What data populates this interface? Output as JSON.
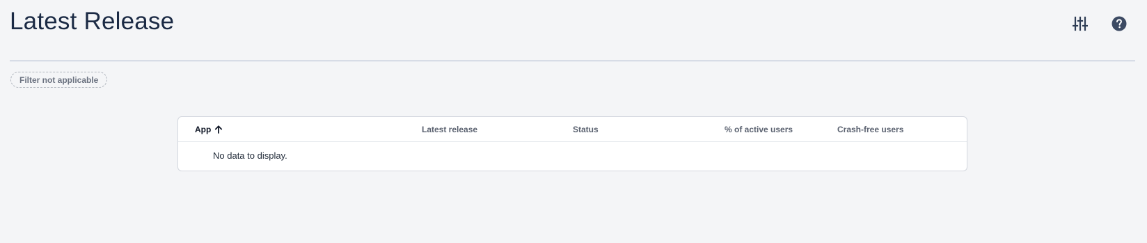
{
  "page": {
    "title": "Latest Release"
  },
  "header_actions": {
    "filter_icon": "tune-sliders-icon",
    "help_icon": "help-icon"
  },
  "filter": {
    "chip_label": "Filter not applicable"
  },
  "table": {
    "columns": [
      {
        "label": "App",
        "sorted": "ascending"
      },
      {
        "label": "Latest release"
      },
      {
        "label": "Status"
      },
      {
        "label": "% of active users"
      },
      {
        "label": "Crash-free users"
      }
    ],
    "empty_message": "No data to display."
  },
  "colors": {
    "background": "#f4f5f7",
    "title": "#1b2a44",
    "icon": "#3c4a63",
    "divider": "#a9b6cc"
  }
}
